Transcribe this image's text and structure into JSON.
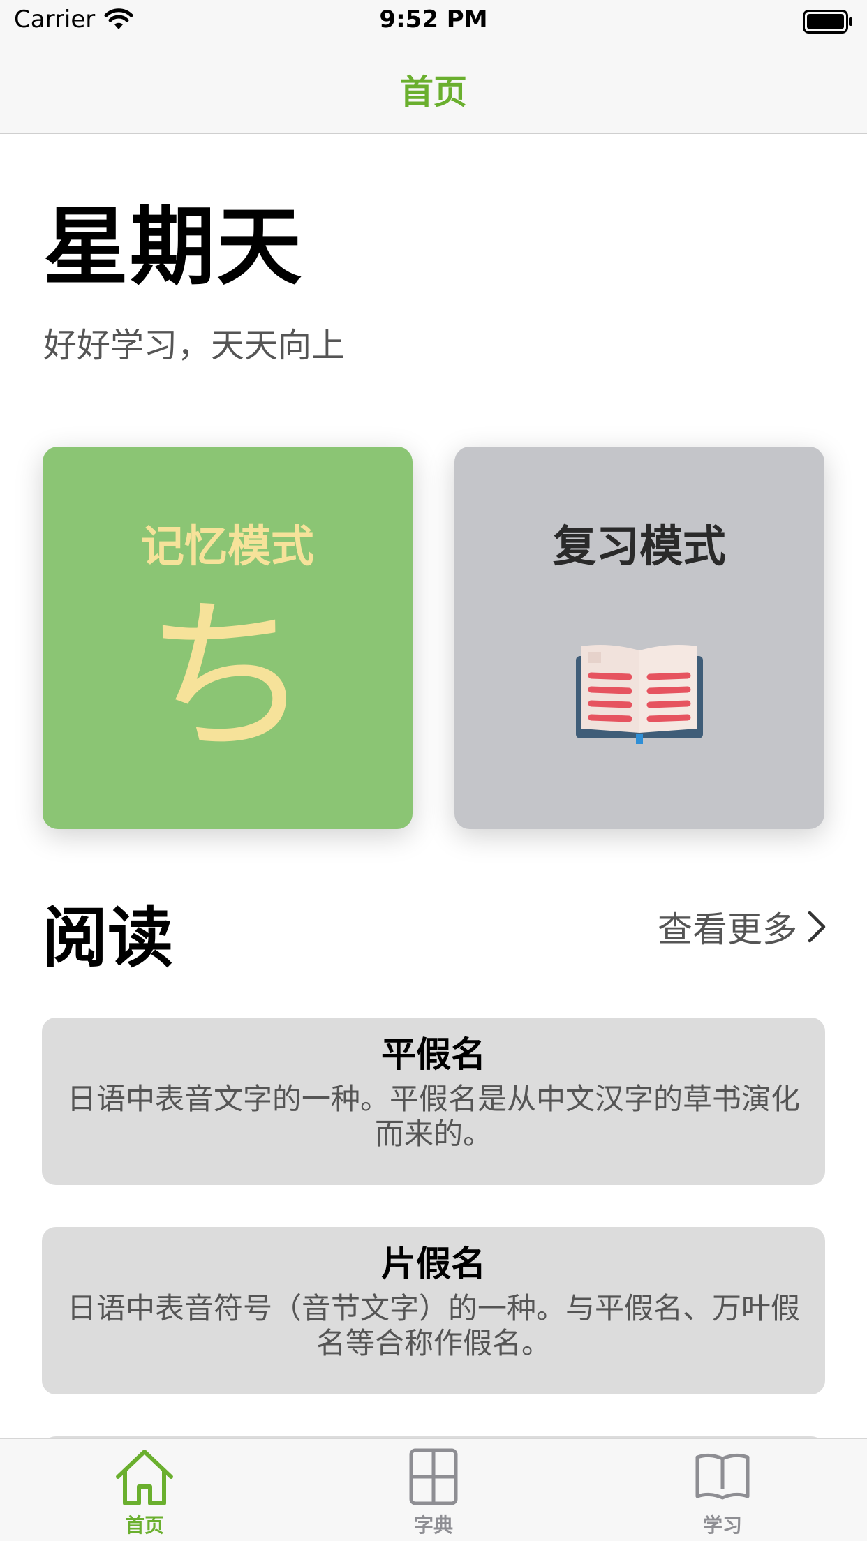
{
  "status_bar": {
    "carrier": "Carrier",
    "time": "9:52 PM",
    "icons": [
      "wifi-icon",
      "battery-icon"
    ]
  },
  "nav": {
    "title": "首页",
    "accent_color": "#6aaf2e"
  },
  "header": {
    "day": "星期天",
    "motto": "好好学习，天天向上"
  },
  "modes": {
    "memory": {
      "label": "记忆模式",
      "kana": "ち",
      "background_color": "#8bc574",
      "text_color": "#f6e29a"
    },
    "review": {
      "label": "复习模式",
      "icon": "open-book-icon",
      "background_color": "#c4c5c9"
    }
  },
  "reading": {
    "title": "阅读",
    "see_more": "查看更多",
    "items": [
      {
        "title": "平假名",
        "description": "日语中表音文字的一种。平假名是从中文汉字的草书演化而来的。"
      },
      {
        "title": "片假名",
        "description": "日语中表音符号（音节文字）的一种。与平假名、万叶假名等合称作假名。"
      }
    ]
  },
  "tab_bar": {
    "tabs": [
      {
        "label": "首页",
        "icon": "home-icon",
        "active": true
      },
      {
        "label": "字典",
        "icon": "grid-icon",
        "active": false
      },
      {
        "label": "学习",
        "icon": "book-icon",
        "active": false
      }
    ]
  }
}
